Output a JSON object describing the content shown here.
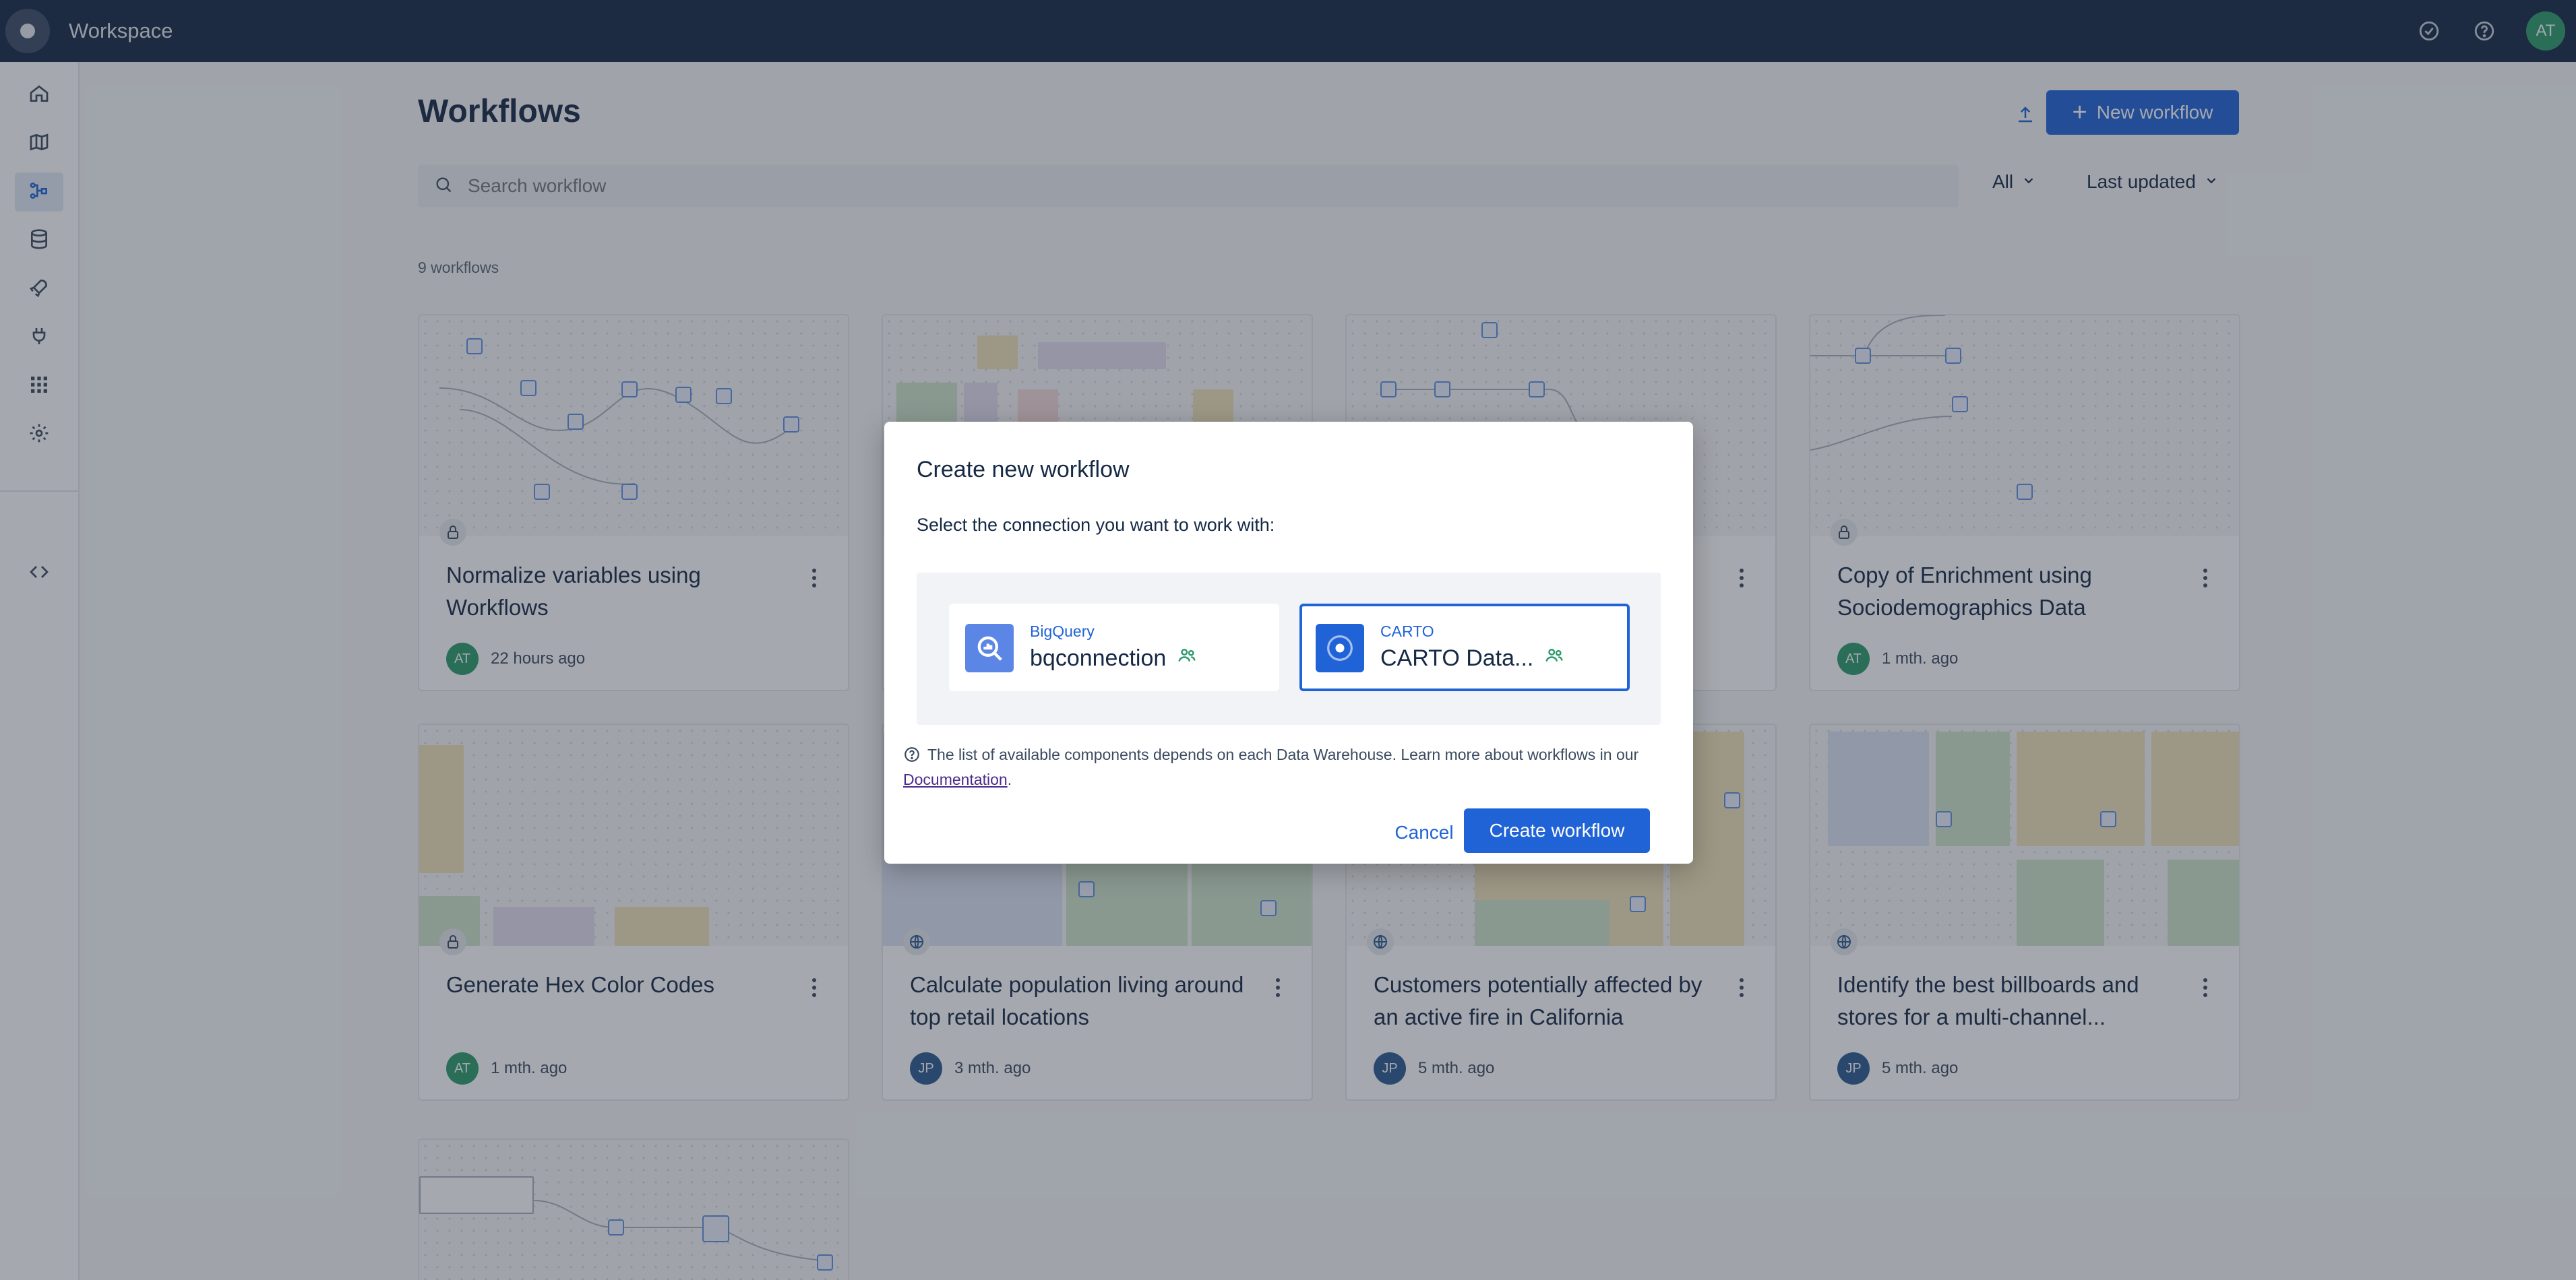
{
  "app": {
    "title": "Workspace",
    "user_initials": "AT"
  },
  "topbar": {
    "icons": [
      "check-circle-icon",
      "help-icon"
    ]
  },
  "sidebar": {
    "items": [
      {
        "icon": "home-icon"
      },
      {
        "icon": "map-icon"
      },
      {
        "icon": "workflows-icon",
        "active": true
      },
      {
        "icon": "database-icon"
      },
      {
        "icon": "rocket-icon"
      },
      {
        "icon": "plug-icon"
      },
      {
        "icon": "apps-grid-icon"
      },
      {
        "icon": "settings-icon"
      },
      {
        "icon": "code-icon"
      }
    ]
  },
  "page": {
    "title": "Workflows",
    "new_button_label": "New workflow",
    "search_placeholder": "Search workflow",
    "filter_label": "All",
    "sort_label": "Last updated",
    "count_label": "9 workflows"
  },
  "cards": [
    {
      "title": "Normalize variables using Workflows",
      "initials": "AT",
      "time": "22 hours ago",
      "visibility": "lock-icon"
    },
    {
      "title": "",
      "initials": "",
      "time": "",
      "visibility": ""
    },
    {
      "title": "",
      "initials": "",
      "time": "",
      "visibility": ""
    },
    {
      "title": "Copy of Enrichment using Sociodemographics Data",
      "initials": "AT",
      "time": "1 mth. ago",
      "visibility": "lock-icon"
    },
    {
      "title": "Generate Hex Color Codes",
      "initials": "AT",
      "time": "1 mth. ago",
      "visibility": "lock-icon"
    },
    {
      "title": "Calculate population living around top retail locations",
      "initials": "JP",
      "time": "3 mth. ago",
      "visibility": "globe-icon"
    },
    {
      "title": "Customers potentially affected by an active fire in California",
      "initials": "JP",
      "time": "5 mth. ago",
      "visibility": "globe-icon"
    },
    {
      "title": "Identify the best billboards and stores for a multi-channel...",
      "initials": "JP",
      "time": "5 mth. ago",
      "visibility": "globe-icon"
    }
  ],
  "modal": {
    "title": "Create new workflow",
    "subtitle": "Select the connection you want to work with:",
    "connections": [
      {
        "provider": "BigQuery",
        "name": "bqconnection",
        "selected": false,
        "icon": "bigquery-icon"
      },
      {
        "provider": "CARTO",
        "name": "CARTO Data...",
        "selected": true,
        "icon": "carto-icon"
      }
    ],
    "info_text": "The list of available components depends on each Data Warehouse. Learn more about workflows in our ",
    "info_link": "Documentation",
    "info_end": ".",
    "cancel_label": "Cancel",
    "create_label": "Create workflow"
  },
  "colors": {
    "accent": "#1f63d6",
    "topbar": "#162945",
    "avatar_at": "#2c9b6c",
    "avatar_jp": "#2c5b8f"
  }
}
